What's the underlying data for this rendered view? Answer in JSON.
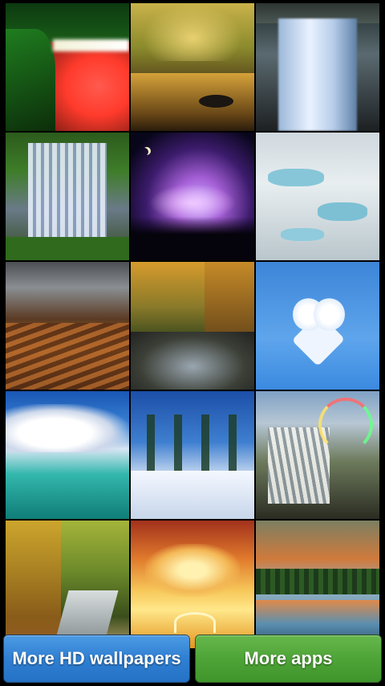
{
  "wallpapers": [
    {
      "icon": "waterfall-night-lit-thumbnail"
    },
    {
      "icon": "forest-stream-autumn-thumbnail"
    },
    {
      "icon": "waterfall-blue-thumbnail"
    },
    {
      "icon": "cascading-waterfall-thumbnail"
    },
    {
      "icon": "purple-lightning-night-thumbnail"
    },
    {
      "icon": "white-terraces-pools-thumbnail"
    },
    {
      "icon": "sand-dune-shore-thumbnail"
    },
    {
      "icon": "autumn-forest-creek-thumbnail"
    },
    {
      "icon": "heart-cloud-sky-thumbnail"
    },
    {
      "icon": "ocean-clouds-thumbnail"
    },
    {
      "icon": "snowy-forest-thumbnail"
    },
    {
      "icon": "waterfall-rainbow-thumbnail"
    },
    {
      "icon": "autumn-stream-thumbnail"
    },
    {
      "icon": "sunset-clouds-balloon-thumbnail"
    },
    {
      "icon": "lake-reflection-sunset-thumbnail"
    }
  ],
  "buttons": {
    "more_wallpapers": "More HD wallpapers",
    "more_apps": "More apps"
  },
  "colors": {
    "background": "#000000",
    "button_blue": "#2f7fd2",
    "button_green": "#4ea437"
  }
}
